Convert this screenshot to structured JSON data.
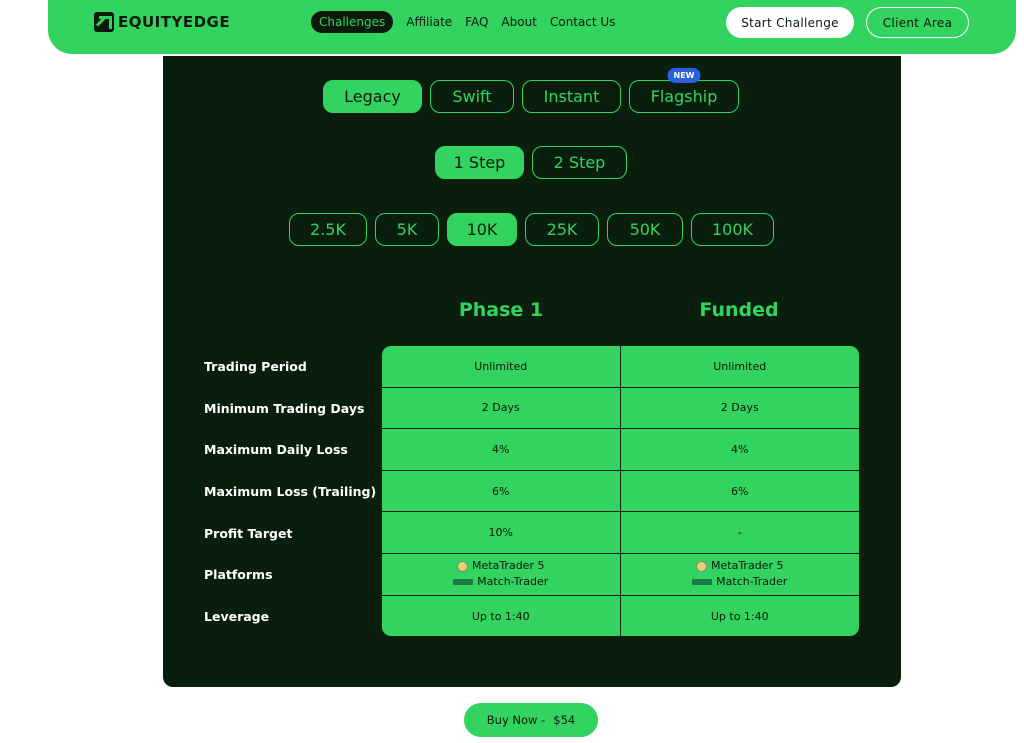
{
  "brand": {
    "name": "EQUITYEDGE",
    "accent": "#33d35f",
    "dark": "#0a1e0e"
  },
  "nav": {
    "items": [
      {
        "label": "Challenges",
        "active": true
      },
      {
        "label": "Affiliate"
      },
      {
        "label": "FAQ"
      },
      {
        "label": "About"
      },
      {
        "label": "Contact Us"
      }
    ],
    "start_label": "Start Challenge",
    "client_label": "Client Area"
  },
  "types": {
    "items": [
      {
        "label": "Legacy",
        "active": true
      },
      {
        "label": "Swift"
      },
      {
        "label": "Instant"
      },
      {
        "label": "Flagship",
        "badge": "NEW"
      }
    ]
  },
  "steps": {
    "items": [
      {
        "label": "1 Step",
        "active": true
      },
      {
        "label": "2 Step"
      }
    ]
  },
  "sizes": {
    "items": [
      {
        "label": "2.5K"
      },
      {
        "label": "5K"
      },
      {
        "label": "10K",
        "active": true
      },
      {
        "label": "25K"
      },
      {
        "label": "50K"
      },
      {
        "label": "100K"
      }
    ]
  },
  "table": {
    "columns": [
      "Phase 1",
      "Funded"
    ],
    "rows": [
      {
        "label": "Trading Period",
        "phase1": "Unlimited",
        "funded": "Unlimited"
      },
      {
        "label": "Minimum Trading Days",
        "phase1": "2 Days",
        "funded": "2 Days"
      },
      {
        "label": "Maximum Daily Loss",
        "phase1": "4%",
        "funded": "4%"
      },
      {
        "label": "Maximum Loss (Trailing)",
        "phase1": "6%",
        "funded": "6%"
      },
      {
        "label": "Profit Target",
        "phase1": "10%",
        "funded": "-"
      },
      {
        "label": "Platforms",
        "phase1": "",
        "funded": ""
      },
      {
        "label": "Leverage",
        "phase1": "Up to 1:40",
        "funded": "Up to 1:40"
      }
    ],
    "platforms": [
      "MetaTrader 5",
      "Match-Trader"
    ]
  },
  "buy": {
    "label": "Buy Now -",
    "price": "$54"
  }
}
